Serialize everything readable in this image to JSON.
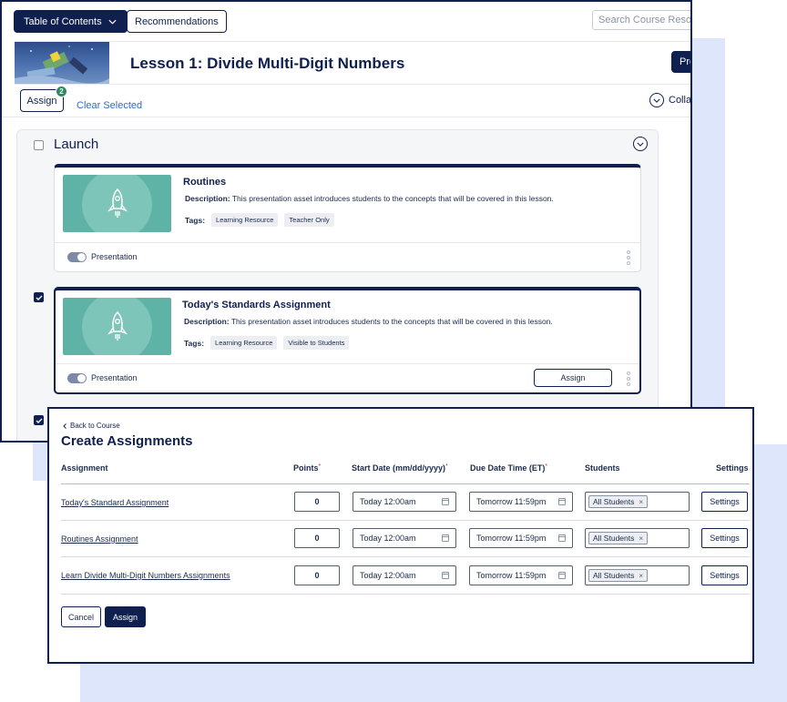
{
  "toolbar": {
    "toc_label": "Table of Contents",
    "recommendations_label": "Recommendations",
    "search_placeholder": "Search Course Resources"
  },
  "lesson": {
    "title": "Lesson 1: Divide Multi-Digit Numbers",
    "preview_label": "Pre"
  },
  "actions": {
    "assign_label": "Assign",
    "assign_count": "2",
    "clear_label": "Clear Selected",
    "collapse_label": "Collapse"
  },
  "section": {
    "title": "Launch",
    "cards": [
      {
        "title": "Routines",
        "desc_label": "Description:",
        "desc": "This presentation asset introduces students to the concepts that will be covered in this lesson.",
        "tags_label": "Tags:",
        "tags": [
          "Learning Resource",
          "Teacher Only"
        ],
        "toggle_label": "Presentation",
        "selected": false
      },
      {
        "title": "Today's Standards Assignment",
        "desc_label": "Description:",
        "desc": "This presentation asset introduces students to the concepts that will be covered in this lesson.",
        "tags_label": "Tags:",
        "tags": [
          "Learning Resource",
          "Visible to Students"
        ],
        "toggle_label": "Presentation",
        "assign_label": "Assign",
        "selected": true
      }
    ]
  },
  "create": {
    "back_label": "Back to Course",
    "title": "Create Assignments",
    "columns": {
      "assignment": "Assignment",
      "points": "Points",
      "start": "Start Date (mm/dd/yyyy)",
      "due": "Due Date Time (ET)",
      "students": "Students",
      "settings": "Settings",
      "required_mark": "*"
    },
    "rows": [
      {
        "name": "Today's Standard Assignment",
        "points": "0",
        "start": "Today 12:00am",
        "due": "Tomorrow 11:59pm",
        "students": "All Students",
        "settings": "Settings"
      },
      {
        "name": "Routines Assignment",
        "points": "0",
        "start": "Today 12:00am",
        "due": "Tomorrow 11:59pm",
        "students": "All Students",
        "settings": "Settings"
      },
      {
        "name": "Learn Divide Multi-Digit Numbers Assignments",
        "points": "0",
        "start": "Today 12:00am",
        "due": "Tomorrow 11:59pm",
        "students": "All Students",
        "settings": "Settings"
      }
    ],
    "chip_remove": "×",
    "cancel_label": "Cancel",
    "assign_label": "Assign"
  },
  "colors": {
    "navy": "#0f1f4f",
    "teal": "#5fb3a6",
    "link_blue": "#2f6fc0",
    "badge_green": "#2e8a5e",
    "backdrop": "#dde6fb"
  }
}
